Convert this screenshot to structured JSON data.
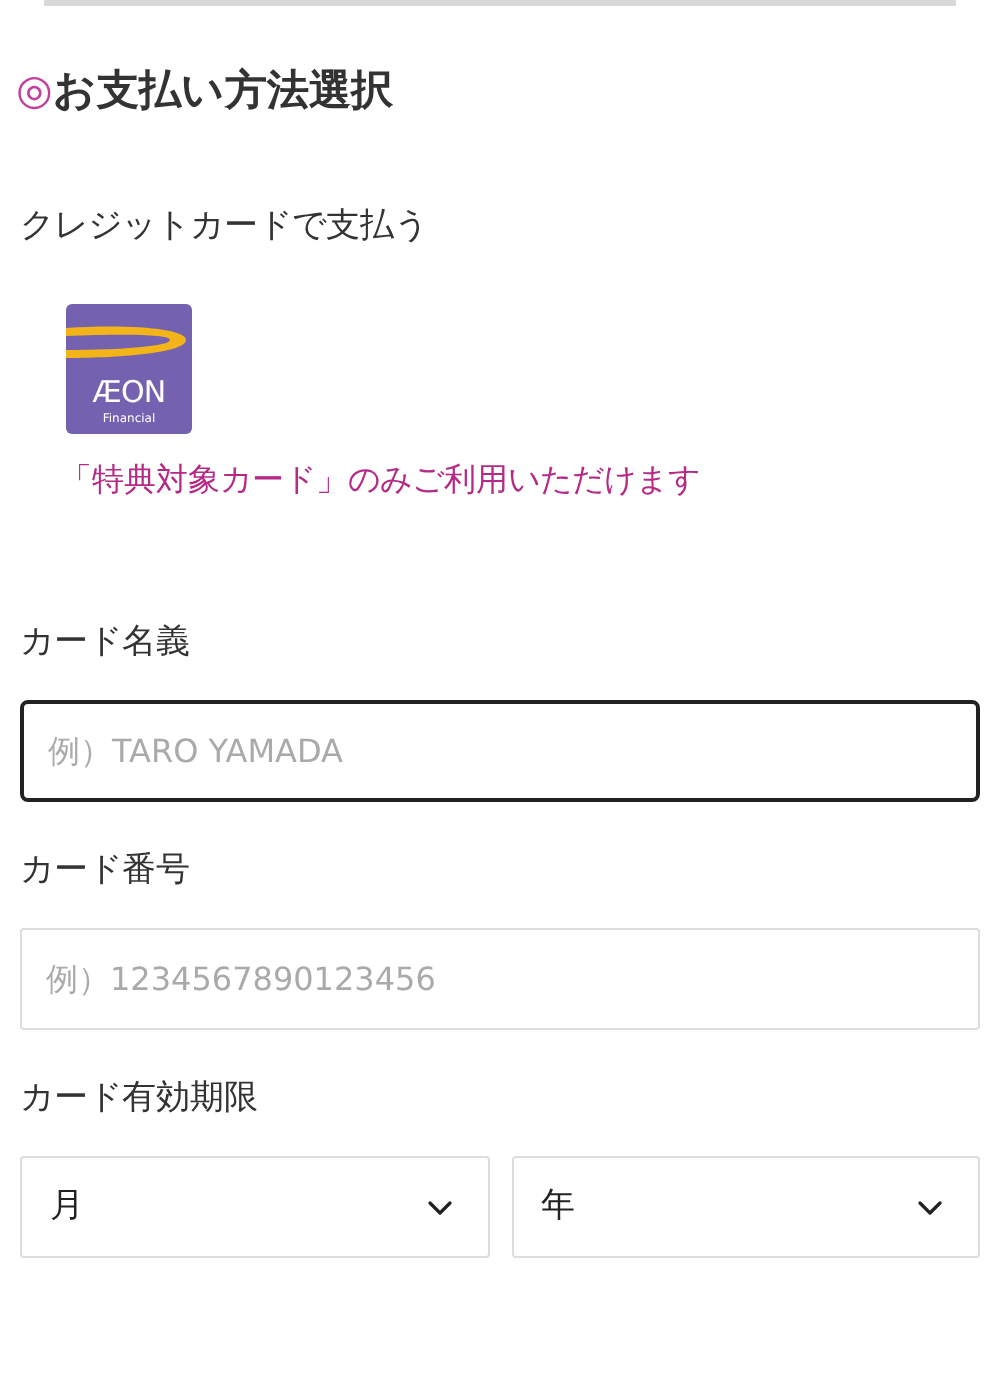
{
  "heading": {
    "mark": "◎",
    "title": "お支払い方法選択"
  },
  "method": {
    "label": "クレジットカードで支払う",
    "logo": {
      "name": "ÆON",
      "sub": "Financial"
    },
    "notice": "「特典対象カード」のみご利用いただけます"
  },
  "fields": [
    {
      "kind": "text",
      "label": "カード名義",
      "placeholder": "例）TARO YAMADA",
      "focused": true
    },
    {
      "kind": "text",
      "label": "カード番号",
      "placeholder": "例）1234567890123456",
      "focused": false
    },
    {
      "kind": "select",
      "label": "カード有効期限",
      "options": [
        "月",
        "年"
      ]
    }
  ]
}
